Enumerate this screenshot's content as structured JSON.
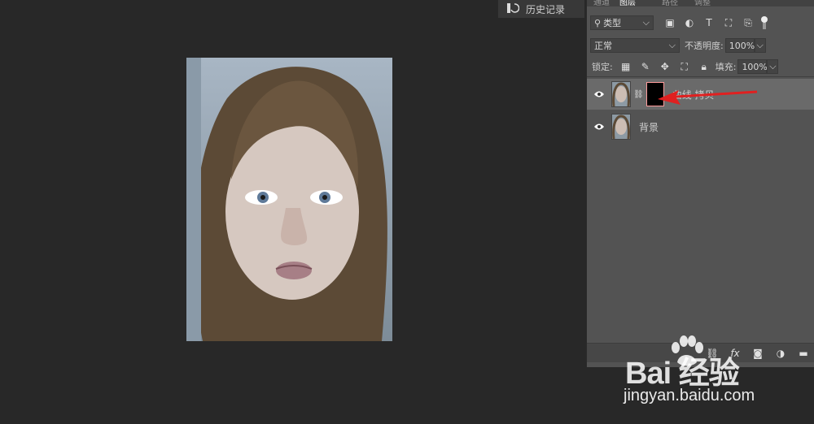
{
  "history_tab": {
    "label": "历史记录",
    "icon": "history-icon"
  },
  "panel": {
    "tabs": [
      "通道",
      "图层",
      "路径",
      "调整"
    ],
    "filter": {
      "kind_label": "类型",
      "icons": [
        "image-filter-icon",
        "adjustment-filter-icon",
        "type-filter-icon",
        "shape-filter-icon",
        "smart-object-filter-icon",
        "filter-toggle-icon"
      ]
    },
    "blend": {
      "mode": "正常",
      "opacity_label": "不透明度:",
      "opacity_value": "100%"
    },
    "lock": {
      "label": "锁定:",
      "fill_label": "填充:",
      "fill_value": "100%"
    },
    "layers": [
      {
        "name": "曲线 拷贝",
        "selected": true,
        "has_mask": true
      },
      {
        "name": "背景",
        "selected": false,
        "has_mask": false
      }
    ],
    "bottom_icons": [
      "link-icon",
      "fx-icon",
      "mask-icon",
      "adjustment-icon",
      "folder-icon"
    ],
    "fx_label": "fx"
  },
  "watermark": {
    "logo": "Bai 经验",
    "url": "jingyan.baidu.com"
  },
  "colors": {
    "panel_bg": "#535353",
    "selected_row": "#6a6a6a",
    "arrow": "#e02020"
  }
}
